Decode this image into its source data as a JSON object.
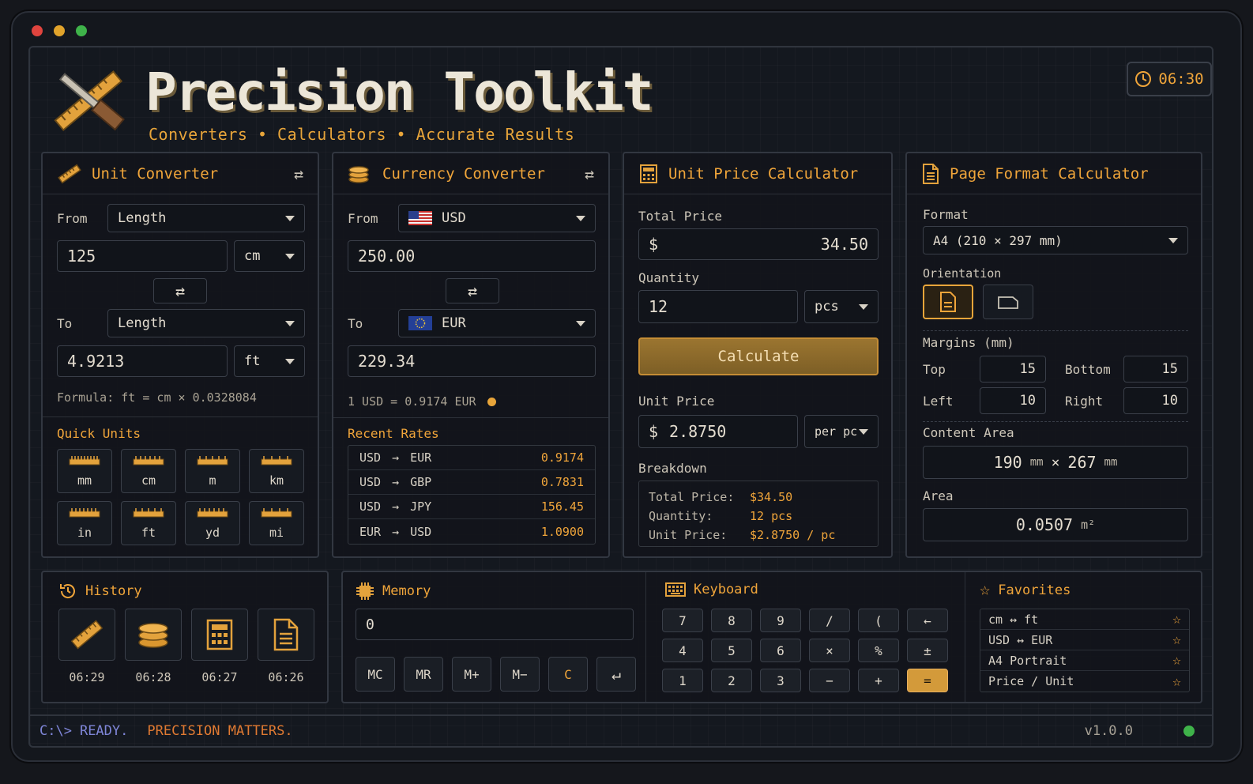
{
  "app": {
    "title": "Precision Toolkit",
    "subtitle": "Converters • Calculators • Accurate Results",
    "clock": "06:30"
  },
  "unit_converter": {
    "title": "Unit Converter",
    "from_label": "From",
    "from_category": "Length",
    "from_value": "125",
    "from_unit": "cm",
    "to_label": "To",
    "to_category": "Length",
    "to_value": "4.9213",
    "to_unit": "ft",
    "formula": "Formula: ft = cm × 0.0328084",
    "quick_title": "Quick Units",
    "quick_units": [
      "mm",
      "cm",
      "m",
      "km",
      "in",
      "ft",
      "yd",
      "mi"
    ]
  },
  "currency_converter": {
    "title": "Currency Converter",
    "from_label": "From",
    "from_currency": "USD",
    "from_amount": "250.00",
    "to_label": "To",
    "to_currency": "EUR",
    "to_amount": "229.34",
    "rate_text": "1 USD = 0.9174 EUR",
    "recent_title": "Recent Rates",
    "rates": [
      {
        "from": "USD",
        "to": "EUR",
        "rate": "0.9174"
      },
      {
        "from": "USD",
        "to": "GBP",
        "rate": "0.7831"
      },
      {
        "from": "USD",
        "to": "JPY",
        "rate": "156.45"
      },
      {
        "from": "EUR",
        "to": "USD",
        "rate": "1.0900"
      }
    ],
    "arrow": "→"
  },
  "unit_price": {
    "title": "Unit Price Calculator",
    "total_label": "Total Price",
    "currency_symbol": "$",
    "total_value": "34.50",
    "quantity_label": "Quantity",
    "quantity_value": "12",
    "quantity_unit": "pcs",
    "calculate_label": "Calculate",
    "unit_price_label": "Unit Price",
    "unit_price_value": "2.8750",
    "unit_price_unit": "per pc",
    "breakdown_label": "Breakdown",
    "breakdown": [
      {
        "key": "Total Price:",
        "value": "$34.50"
      },
      {
        "key": "Quantity:",
        "value": "12 pcs"
      },
      {
        "key": "Unit Price:",
        "value": "$2.8750 / pc"
      }
    ]
  },
  "page_format": {
    "title": "Page Format Calculator",
    "format_label": "Format",
    "format_value": "A4 (210 × 297 mm)",
    "orientation_label": "Orientation",
    "margins_label": "Margins (mm)",
    "top_label": "Top",
    "top_value": "15",
    "bottom_label": "Bottom",
    "bottom_value": "15",
    "left_label": "Left",
    "left_value": "10",
    "right_label": "Right",
    "right_value": "10",
    "content_label": "Content Area",
    "content_w": "190",
    "content_h": "267",
    "content_unit": "mm",
    "times": "×",
    "area_label": "Area",
    "area_value": "0.0507",
    "area_unit": "m²"
  },
  "history": {
    "title": "History",
    "items": [
      {
        "icon": "ruler-icon",
        "time": "06:29"
      },
      {
        "icon": "coins-icon",
        "time": "06:28"
      },
      {
        "icon": "calculator-icon",
        "time": "06:27"
      },
      {
        "icon": "document-icon",
        "time": "06:26"
      }
    ]
  },
  "memory": {
    "title": "Memory",
    "value": "0",
    "buttons": [
      "MC",
      "MR",
      "M+",
      "M−",
      "C",
      "↵"
    ]
  },
  "keyboard": {
    "title": "Keyboard",
    "keys": [
      "7",
      "8",
      "9",
      "/",
      "(",
      "←",
      "4",
      "5",
      "6",
      "×",
      "%",
      "±",
      "1",
      "2",
      "3",
      "−",
      "+",
      "="
    ]
  },
  "favorites": {
    "title": "Favorites",
    "items": [
      "cm ↔ ft",
      "USD ↔ EUR",
      "A4 Portrait",
      "Price / Unit"
    ]
  },
  "status": {
    "prompt": "C:\\>",
    "ready": "READY.",
    "message": "PRECISION MATTERS.",
    "version": "v1.0.0"
  },
  "colors": {
    "accent": "#f0a53a",
    "background": "#14181f",
    "status_ok": "#3fb34a"
  }
}
